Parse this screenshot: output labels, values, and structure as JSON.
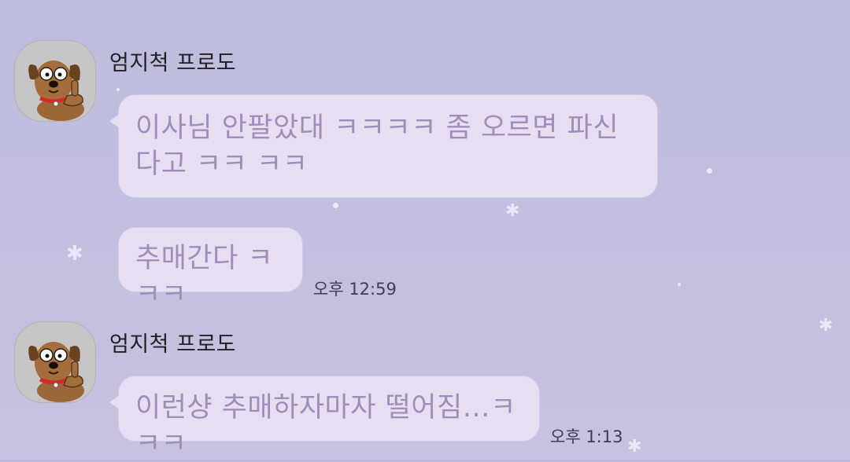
{
  "messages": [
    {
      "sender": "엄지척 프로도",
      "avatar_icon": "frodo-dog-thumbs-up-icon",
      "bubbles": [
        {
          "text": "이사님 안팔았대 ㅋㅋㅋㅋ 좀 오르면 파신다고 ㅋㅋ ㅋㅋ",
          "time": ""
        },
        {
          "text": "추매간다 ㅋㅋㅋ",
          "time": "오후 12:59"
        }
      ]
    },
    {
      "sender": "엄지척 프로도",
      "avatar_icon": "frodo-dog-thumbs-up-icon",
      "bubbles": [
        {
          "text": "이런샹 추매하자마자 떨어짐…ㅋㅋㅋ",
          "time": "오후 1:13"
        }
      ]
    }
  ],
  "theme": {
    "background": "#c2bfe0",
    "bubble_color": "#e8def1",
    "bubble_text_color": "#9e8fba",
    "name_color": "#1f1f24",
    "timestamp_color": "#3f3d4d"
  }
}
